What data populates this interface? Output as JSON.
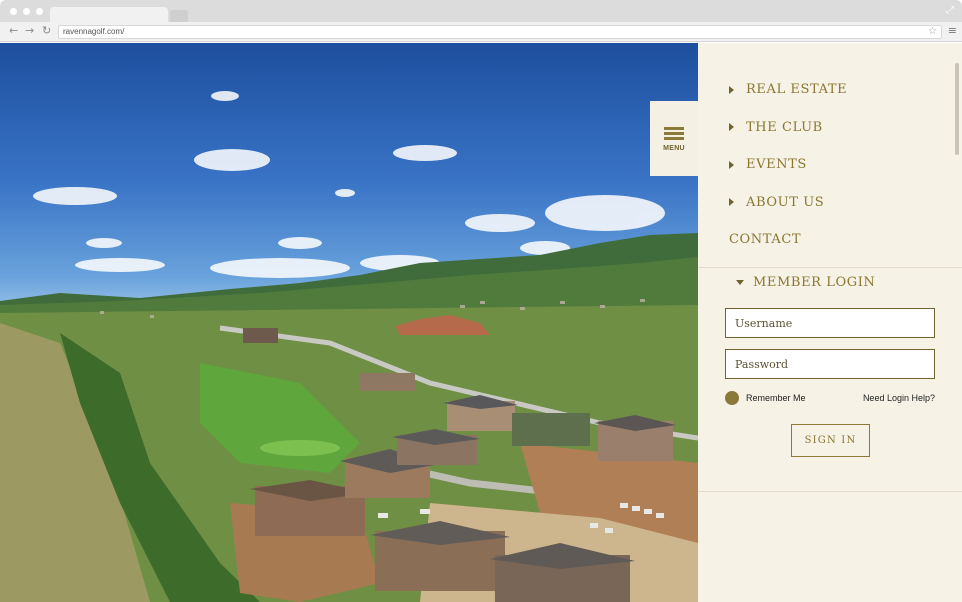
{
  "browser": {
    "url": "ravennagolf.com/"
  },
  "menu_tab": {
    "label": "MENU"
  },
  "nav": {
    "items": [
      {
        "label": "REAL ESTATE",
        "has_caret": true
      },
      {
        "label": "THE CLUB",
        "has_caret": true
      },
      {
        "label": "EVENTS",
        "has_caret": true
      },
      {
        "label": "ABOUT US",
        "has_caret": true
      },
      {
        "label": "CONTACT",
        "has_caret": false
      }
    ]
  },
  "login": {
    "heading": "MEMBER LOGIN",
    "username_placeholder": "Username",
    "password_placeholder": "Password",
    "remember_label": "Remember Me",
    "help_link": "Need Login Help?",
    "signin_label": "SIGN IN"
  },
  "colors": {
    "accent": "#8b7632",
    "panel_bg": "#f6f2e6"
  }
}
